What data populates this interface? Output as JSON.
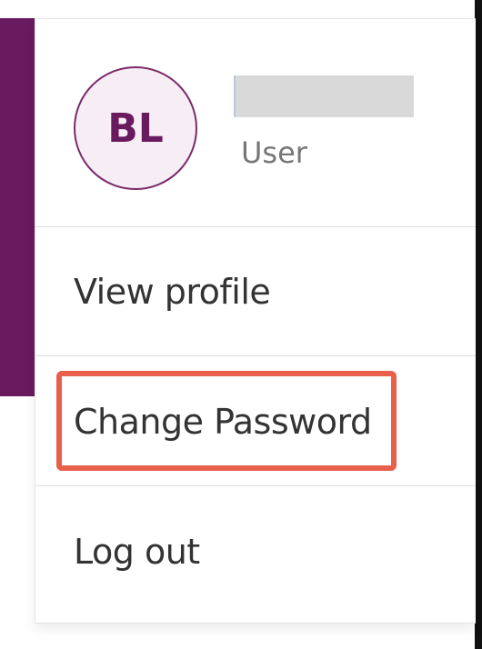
{
  "user_menu": {
    "avatar_initials": "BL",
    "user_name": "",
    "user_role": "User",
    "items": [
      {
        "label": "View profile"
      },
      {
        "label": "Change Password"
      },
      {
        "label": "Log out"
      }
    ]
  },
  "colors": {
    "brand_purple": "#6a1a5f",
    "highlight": "#e8604c",
    "name_redaction": "#d9d9d9"
  }
}
